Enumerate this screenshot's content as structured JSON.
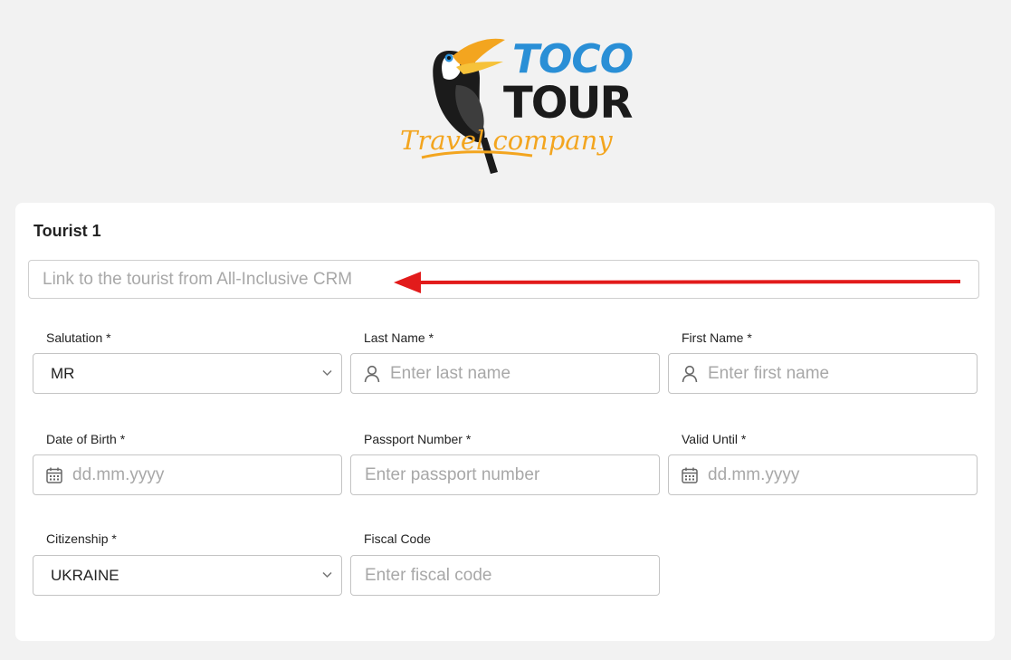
{
  "logo": {
    "line1": "TOCO",
    "line2": "TOUR",
    "tagline": "Travel company"
  },
  "card": {
    "title": "Tourist 1"
  },
  "crm_link": {
    "placeholder": "Link to the tourist from All-Inclusive CRM"
  },
  "fields": {
    "salutation": {
      "label": "Salutation *",
      "value": "MR",
      "icon": "chevron-down-icon"
    },
    "last_name": {
      "label": "Last Name *",
      "placeholder": "Enter last name",
      "icon": "user-icon"
    },
    "first_name": {
      "label": "First Name *",
      "placeholder": "Enter first name",
      "icon": "user-icon"
    },
    "dob": {
      "label": "Date of Birth *",
      "placeholder": "dd.mm.yyyy",
      "icon": "calendar-icon"
    },
    "passport": {
      "label": "Passport Number *",
      "placeholder": "Enter passport number"
    },
    "valid_until": {
      "label": "Valid Until *",
      "placeholder": "dd.mm.yyyy",
      "icon": "calendar-icon"
    },
    "citizenship": {
      "label": "Citizenship *",
      "value": "UKRAINE",
      "icon": "chevron-down-icon"
    },
    "fiscal_code": {
      "label": "Fiscal Code",
      "placeholder": "Enter fiscal code"
    }
  },
  "colors": {
    "page_bg": "#f2f2f2",
    "card_bg": "#ffffff",
    "arrow": "#e21b1b",
    "logo_blue": "#2a8fd6",
    "logo_dark": "#1b1b1b",
    "logo_orange": "#f3a51f"
  }
}
